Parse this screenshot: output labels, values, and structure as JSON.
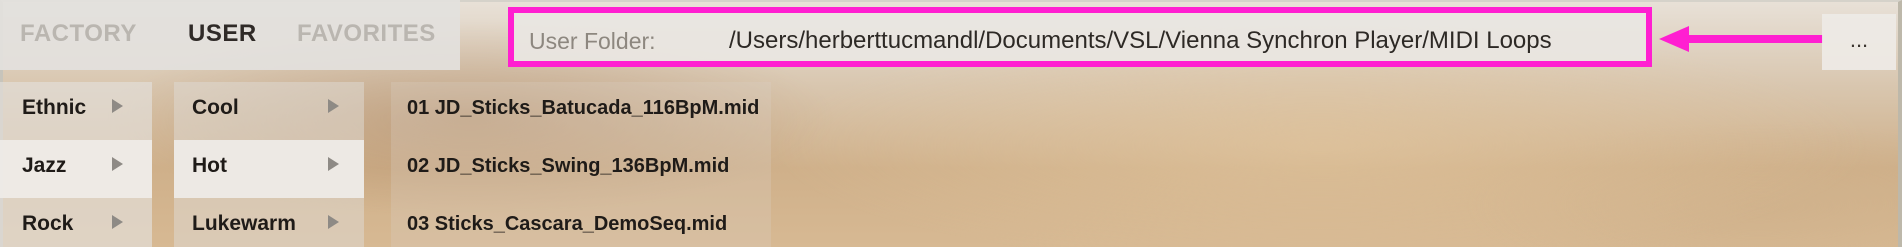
{
  "tabs": [
    {
      "label": "FACTORY",
      "active": false
    },
    {
      "label": "USER",
      "active": true
    },
    {
      "label": "FAVORITES",
      "active": false
    }
  ],
  "user_folder": {
    "label": "User Folder:",
    "path": "/Users/herberttucmandl/Documents/VSL/Vienna Synchron Player/MIDI Loops"
  },
  "browse_button": {
    "label": "..."
  },
  "columns": {
    "styles": [
      {
        "label": "Ethnic",
        "selected": false
      },
      {
        "label": "Jazz",
        "selected": true
      },
      {
        "label": "Rock",
        "selected": false
      }
    ],
    "moods": [
      {
        "label": "Cool",
        "selected": false
      },
      {
        "label": "Hot",
        "selected": true
      },
      {
        "label": "Lukewarm",
        "selected": false
      }
    ],
    "files": [
      {
        "label": "01 JD_Sticks_Batucada_116BpM.mid"
      },
      {
        "label": "02 JD_Sticks_Swing_136BpM.mid"
      },
      {
        "label": "03 Sticks_Cascara_DemoSeq.mid"
      }
    ]
  },
  "colors": {
    "highlight": "#ff1fd1",
    "active_tab": "#2f2a27",
    "inactive_tab": "#bab6b0"
  },
  "icons": {
    "annotation_arrow": "left-arrow-icon",
    "submenu": "chevron-right-icon"
  }
}
